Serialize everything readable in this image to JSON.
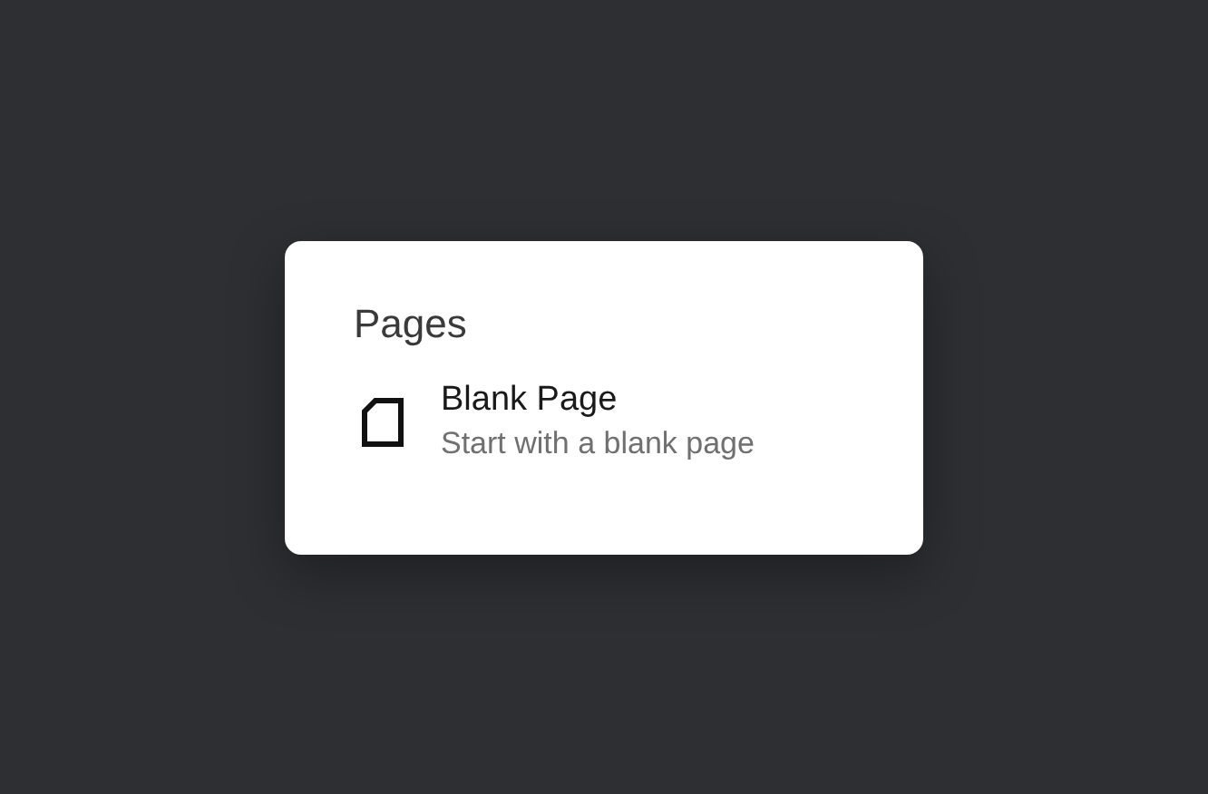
{
  "panel": {
    "title": "Pages",
    "items": [
      {
        "title": "Blank Page",
        "description": "Start with a blank page"
      }
    ]
  }
}
